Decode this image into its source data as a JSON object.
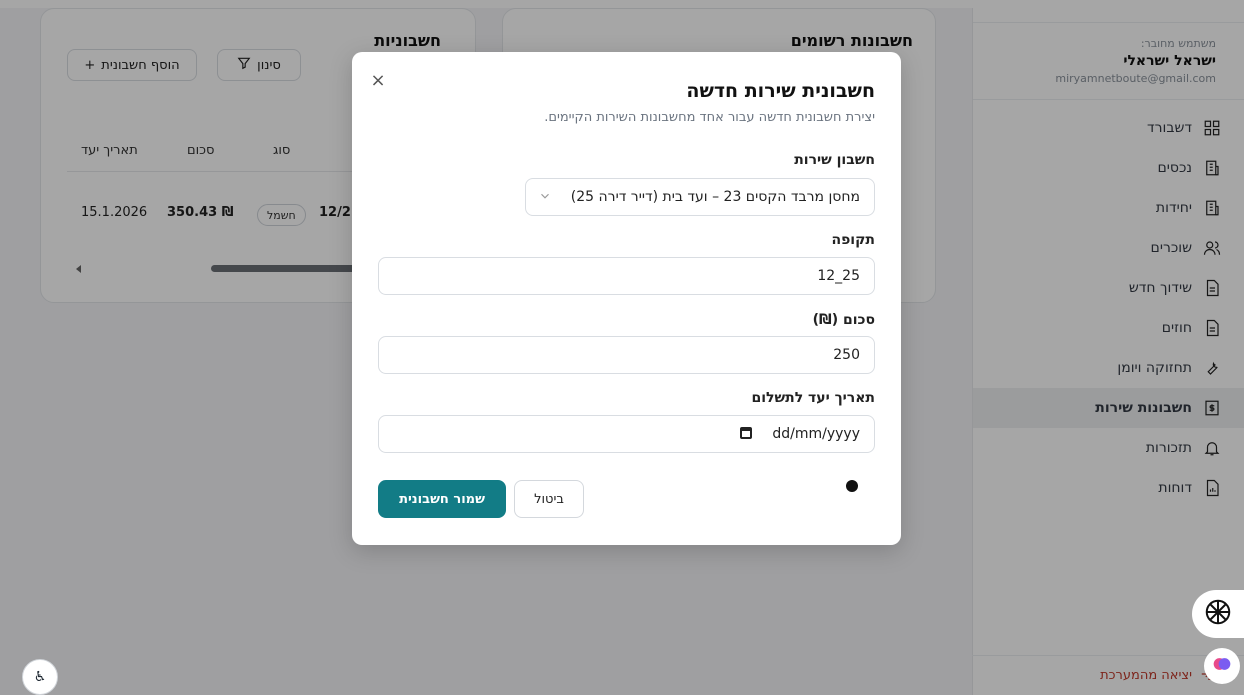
{
  "sidebar": {
    "user_caption": "משתמש מחובר:",
    "user_name": "ישראל ישראלי",
    "user_email": "miryamnetboute@gmail.com",
    "items": [
      {
        "label": "דשבורד",
        "icon": "dashboard-icon"
      },
      {
        "label": "נכסים",
        "icon": "building-icon"
      },
      {
        "label": "יחידות",
        "icon": "building-icon"
      },
      {
        "label": "שוכרים",
        "icon": "users-icon"
      },
      {
        "label": "שידוך חדש",
        "icon": "document-icon"
      },
      {
        "label": "חוזים",
        "icon": "document-icon"
      },
      {
        "label": "תחזוקה ויומן",
        "icon": "wrench-icon"
      },
      {
        "label": "חשבונות שירות",
        "icon": "bill-icon",
        "active": true
      },
      {
        "label": "תזכורות",
        "icon": "bell-icon"
      },
      {
        "label": "דוחות",
        "icon": "report-icon"
      }
    ],
    "logout_label": "יציאה מהמערכת"
  },
  "registered_card": {
    "title": "חשבונות רשומים",
    "subtitle_fragment": "ח"
  },
  "bills_card": {
    "title": "חשבוניות",
    "filter_label": "סינון",
    "add_label": "הוסף חשבונית",
    "hidden_fragment": "ות",
    "columns": [
      "סוג",
      "סכום",
      "תאריך יעד"
    ],
    "row": {
      "period": "12/2",
      "type": "חשמל",
      "amount": "350.43 ₪",
      "due": "15.1.2026"
    }
  },
  "modal": {
    "title": "חשבונית שירות חדשה",
    "subtitle": "יצירת חשבונית חדשה עבור אחד מחשבונות השירות הקיימים.",
    "close_symbol": "×",
    "account_label": "חשבון שירות",
    "account_value": "מחסן מרבד הקסים 23 – ועד בית (דייר דירה 25)",
    "period_label": "תקופה",
    "period_value": "25_12",
    "amount_label": "סכום (₪)",
    "amount_value": "250",
    "due_label": "תאריך יעד לתשלום",
    "due_placeholder": "dd/mm/yyyy",
    "save_label": "שמור חשבונית",
    "cancel_label": "ביטול"
  },
  "accessibility_label": "♿"
}
